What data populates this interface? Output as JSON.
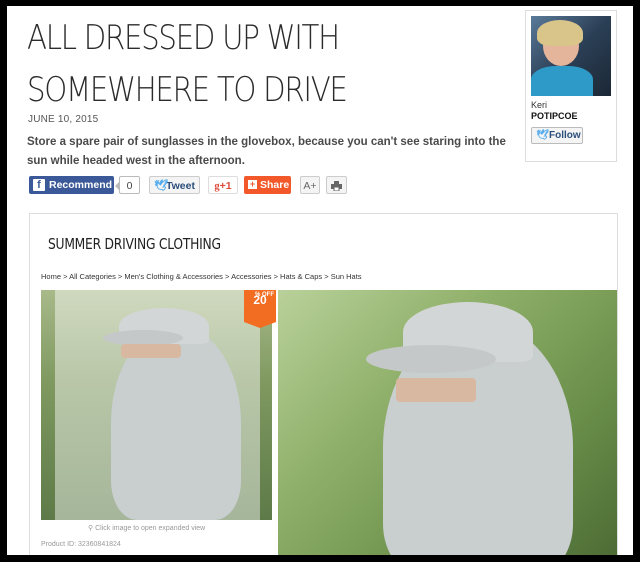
{
  "article": {
    "title": "ALL DRESSED UP WITH SOMEWHERE TO DRIVE",
    "date": "JUNE 10, 2015",
    "subtitle": "Store a spare pair of sunglasses in the glovebox, because you can't see staring into the sun while headed west in the afternoon."
  },
  "share": {
    "recommend_label": "Recommend",
    "recommend_count": "0",
    "tweet_label": "Tweet",
    "gplus_label": "+1",
    "share_label": "Share",
    "font_size_label": "A+",
    "print_icon": "printer-icon"
  },
  "author": {
    "first_name": "Keri",
    "last_name": "POTIPCOE",
    "follow_label": "Follow"
  },
  "embed": {
    "title": "SUMMER DRIVING CLOTHING",
    "breadcrumb": "Home > All Categories > Men's Clothing & Accessories > Accessories > Hats & Caps > Sun Hats",
    "discount": "20",
    "discount_unit": "% OFF",
    "image_hint": "Click image to open expanded view",
    "product_id": "Product ID: 32360841824"
  },
  "colors": {
    "facebook": "#3b5998",
    "twitter": "#55acee",
    "share": "#f2582a",
    "discount_badge": "#f26c21"
  }
}
